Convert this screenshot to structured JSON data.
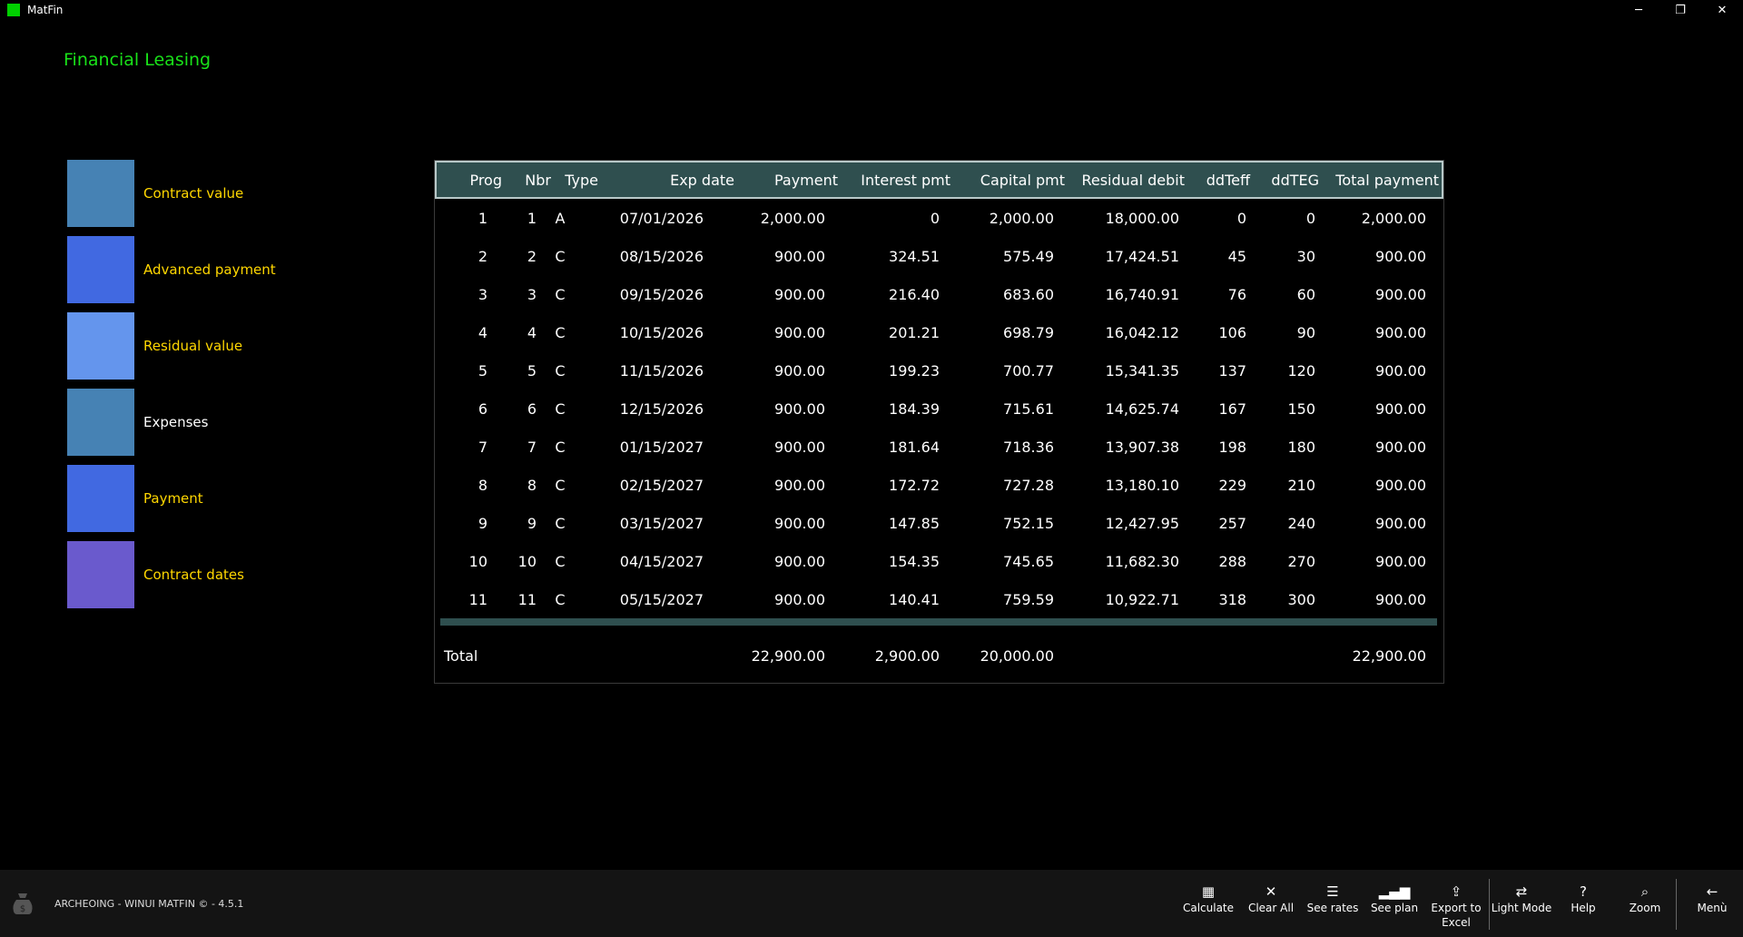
{
  "window": {
    "title": "MatFin",
    "min": "─",
    "max": "❐",
    "close": "✕"
  },
  "page_title": "Financial Leasing",
  "legend": [
    {
      "label": "Contract value",
      "color": "#4682b4",
      "text_color": "#ffd700"
    },
    {
      "label": "Advanced payment",
      "color": "#4169e1",
      "text_color": "#ffd700"
    },
    {
      "label": "Residual value",
      "color": "#6495ed",
      "text_color": "#ffd700"
    },
    {
      "label": "Expenses",
      "color": "#4682b4",
      "text_color": "#ffffff"
    },
    {
      "label": "Payment",
      "color": "#4169e1",
      "text_color": "#ffd700"
    },
    {
      "label": "Contract dates",
      "color": "#6a5acd",
      "text_color": "#ffd700"
    }
  ],
  "table": {
    "headers": [
      "Prog",
      "Nbr",
      "Type",
      "Exp date",
      "Payment",
      "Interest pmt",
      "Capital pmt",
      "Residual debit",
      "ddTeff",
      "ddTEG",
      "Total payment"
    ],
    "rows": [
      [
        "1",
        "1",
        "A",
        "07/01/2026",
        "2,000.00",
        "0",
        "2,000.00",
        "18,000.00",
        "0",
        "0",
        "2,000.00"
      ],
      [
        "2",
        "2",
        "C",
        "08/15/2026",
        "900.00",
        "324.51",
        "575.49",
        "17,424.51",
        "45",
        "30",
        "900.00"
      ],
      [
        "3",
        "3",
        "C",
        "09/15/2026",
        "900.00",
        "216.40",
        "683.60",
        "16,740.91",
        "76",
        "60",
        "900.00"
      ],
      [
        "4",
        "4",
        "C",
        "10/15/2026",
        "900.00",
        "201.21",
        "698.79",
        "16,042.12",
        "106",
        "90",
        "900.00"
      ],
      [
        "5",
        "5",
        "C",
        "11/15/2026",
        "900.00",
        "199.23",
        "700.77",
        "15,341.35",
        "137",
        "120",
        "900.00"
      ],
      [
        "6",
        "6",
        "C",
        "12/15/2026",
        "900.00",
        "184.39",
        "715.61",
        "14,625.74",
        "167",
        "150",
        "900.00"
      ],
      [
        "7",
        "7",
        "C",
        "01/15/2027",
        "900.00",
        "181.64",
        "718.36",
        "13,907.38",
        "198",
        "180",
        "900.00"
      ],
      [
        "8",
        "8",
        "C",
        "02/15/2027",
        "900.00",
        "172.72",
        "727.28",
        "13,180.10",
        "229",
        "210",
        "900.00"
      ],
      [
        "9",
        "9",
        "C",
        "03/15/2027",
        "900.00",
        "147.85",
        "752.15",
        "12,427.95",
        "257",
        "240",
        "900.00"
      ],
      [
        "10",
        "10",
        "C",
        "04/15/2027",
        "900.00",
        "154.35",
        "745.65",
        "11,682.30",
        "288",
        "270",
        "900.00"
      ],
      [
        "11",
        "11",
        "C",
        "05/15/2027",
        "900.00",
        "140.41",
        "759.59",
        "10,922.71",
        "318",
        "300",
        "900.00"
      ]
    ],
    "total": {
      "label": "Total",
      "payment": "22,900.00",
      "interest": "2,900.00",
      "capital": "20,000.00",
      "total_payment": "22,900.00"
    }
  },
  "footer": {
    "app_text": "ARCHEOING - WINUI MATFIN © - 4.5.1"
  },
  "commands": [
    {
      "label": "Calculate",
      "icon": "▦",
      "name": "calculator"
    },
    {
      "label": "Clear All",
      "icon": "✕",
      "name": "clear"
    },
    {
      "label": "See rates",
      "icon": "☰",
      "name": "list"
    },
    {
      "label": "See plan",
      "icon": "▂▄▆",
      "name": "bar-chart"
    },
    {
      "label": "Export to Excel",
      "icon": "⇪",
      "name": "share"
    },
    {
      "label": "Light Mode",
      "icon": "⇄",
      "name": "shuffle"
    },
    {
      "label": "Help",
      "icon": "?",
      "name": "help"
    },
    {
      "label": "Zoom",
      "icon": "⌕",
      "name": "search"
    },
    {
      "label": "Menù",
      "icon": "←",
      "name": "back"
    }
  ]
}
